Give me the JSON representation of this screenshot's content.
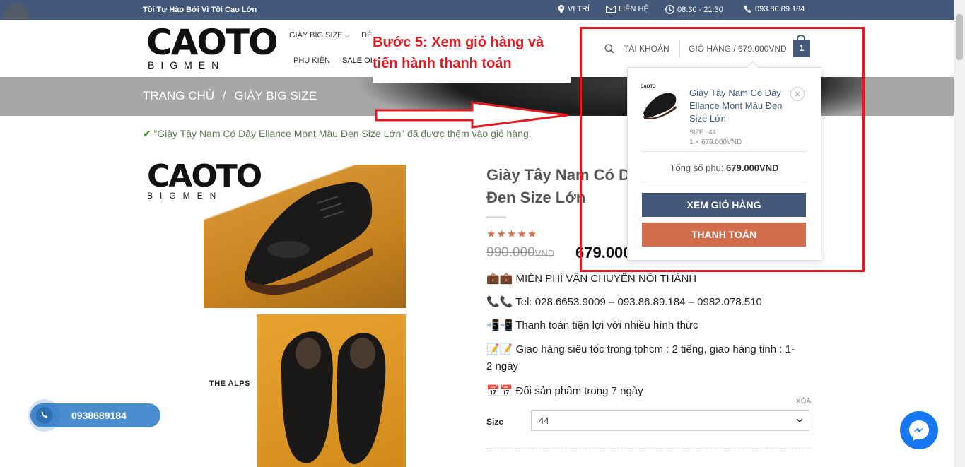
{
  "topbar": {
    "tagline": "Tôi Tự Hào Bởi Vì Tôi Cao Lớn",
    "location": "VỊ TRÍ",
    "contact": "LIÊN HỆ",
    "hours": "08:30 - 21:30",
    "phone": "093.86.89.184"
  },
  "logo": {
    "main": "CAOTO",
    "sub": "BIGMEN"
  },
  "nav": {
    "items": [
      "GIÀY BIG SIZE",
      "DÉ",
      "PHỤ KIỆN",
      "SALE OI"
    ]
  },
  "header_right": {
    "account": "TÀI KHOẢN",
    "cart_label": "GIỎ HÀNG / 679.000VND",
    "cart_count": "1"
  },
  "breadcrumb": {
    "home": "TRANG CHỦ",
    "sep": "/",
    "current": "GIÀY BIG SIZE"
  },
  "notice": "“Giày Tây Nam Có Dây Ellance Mont Màu Đen Size Lớn” đã được thêm vào giỏ hàng.",
  "product": {
    "title_line1": "Giày Tây Nam Có D",
    "title_line2": "Đen Size Lớn",
    "stars": "★★★★★",
    "old_price": "990.000",
    "old_price_unit": "VND",
    "new_price": "679.000",
    "features": [
      "💼💼 MIỄN PHÍ VẬN CHUYỂN NỘI THÀNH",
      "📞📞 Tel: 028.6653.9009 – 093.86.89.184 – 0982.078.510",
      "📲📲 Thanh toán tiện lợi với nhiều hình thức",
      "📝📝 Giao hàng siêu tốc trong tphcm : 2 tiếng, giao hàng tỉnh : 1-",
      "2 ngày",
      "📅📅 Đổi sản phẩm trong 7 ngày"
    ],
    "size_label": "Size",
    "size_value": "44",
    "clear": "XÓA"
  },
  "image": {
    "overlay_logo_main": "CAOTO",
    "overlay_logo_sub": "BIGMEN",
    "brand_tag": "THE ALPS"
  },
  "cart": {
    "item_name": "Giày Tây Nam Có Dây Ellance Mont Màu Đen Size Lớn",
    "item_size_label": "SIZE:",
    "item_size": "44",
    "item_qty": "1 × 679.000VND",
    "thumb_logo": "CAOTO",
    "remove": "×",
    "subtotal_label": "Tổng số phụ:",
    "subtotal_value": "679.000VND",
    "view_cart": "XEM GIỎ HÀNG",
    "checkout": "THANH TOÁN"
  },
  "annotation": {
    "line1": "Bước 5: Xem giỏ hàng và",
    "line2": "tiến hành thanh toán",
    "color": "#e21b22"
  },
  "floating": {
    "phone": "0938689184"
  },
  "colors": {
    "topbar": "#44597a",
    "primary_btn": "#44597a",
    "checkout_btn": "#d26e4b",
    "stars": "#d26e4b"
  }
}
